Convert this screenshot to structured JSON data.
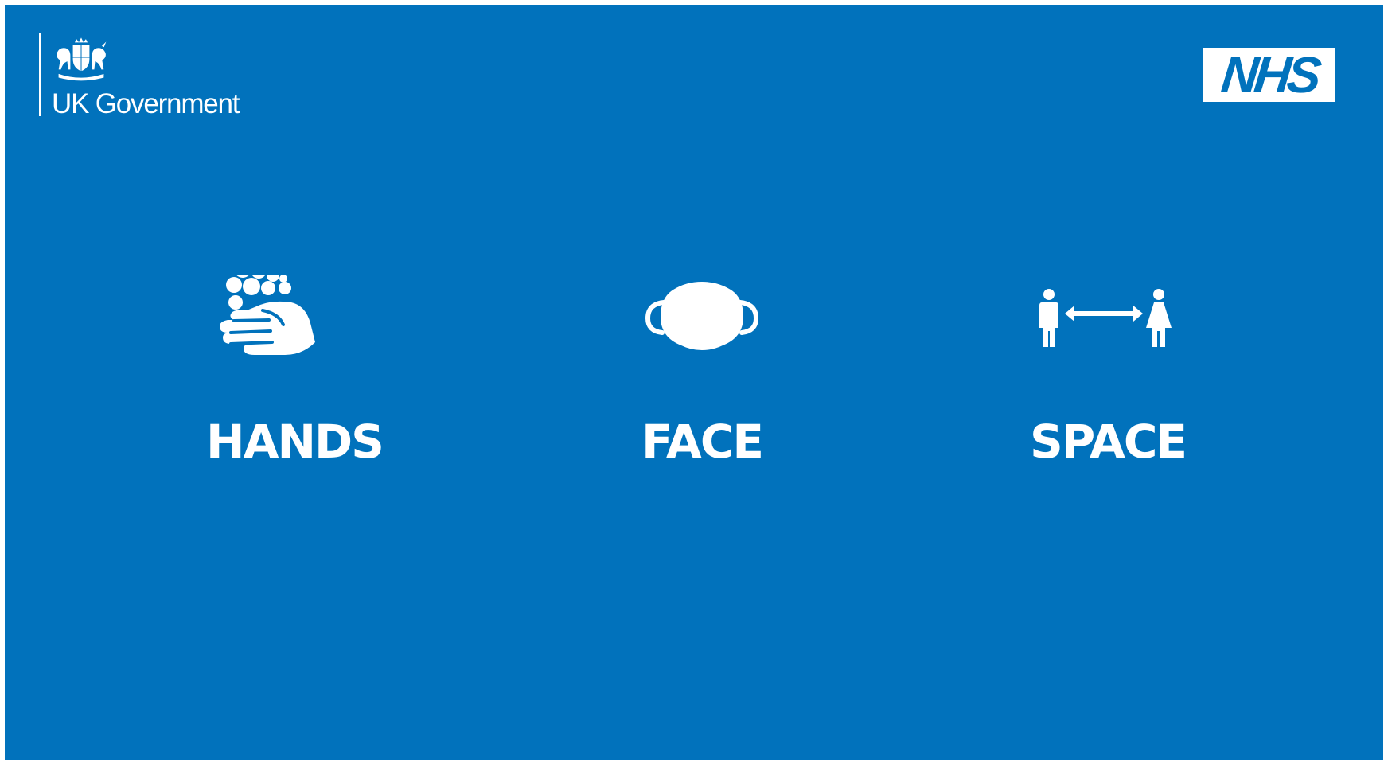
{
  "header": {
    "government_logo": {
      "name": "UK Government",
      "icon": "royal-coat-of-arms-icon"
    },
    "nhs_logo": {
      "text": "NHS"
    }
  },
  "messages": [
    {
      "label": "HANDS",
      "icon": "hand-washing-icon"
    },
    {
      "label": "FACE",
      "icon": "face-mask-icon"
    },
    {
      "label": "SPACE",
      "icon": "social-distance-icon"
    }
  ],
  "colors": {
    "background": "#0172bc",
    "foreground": "#ffffff",
    "nhs_blue": "#0172bc"
  }
}
